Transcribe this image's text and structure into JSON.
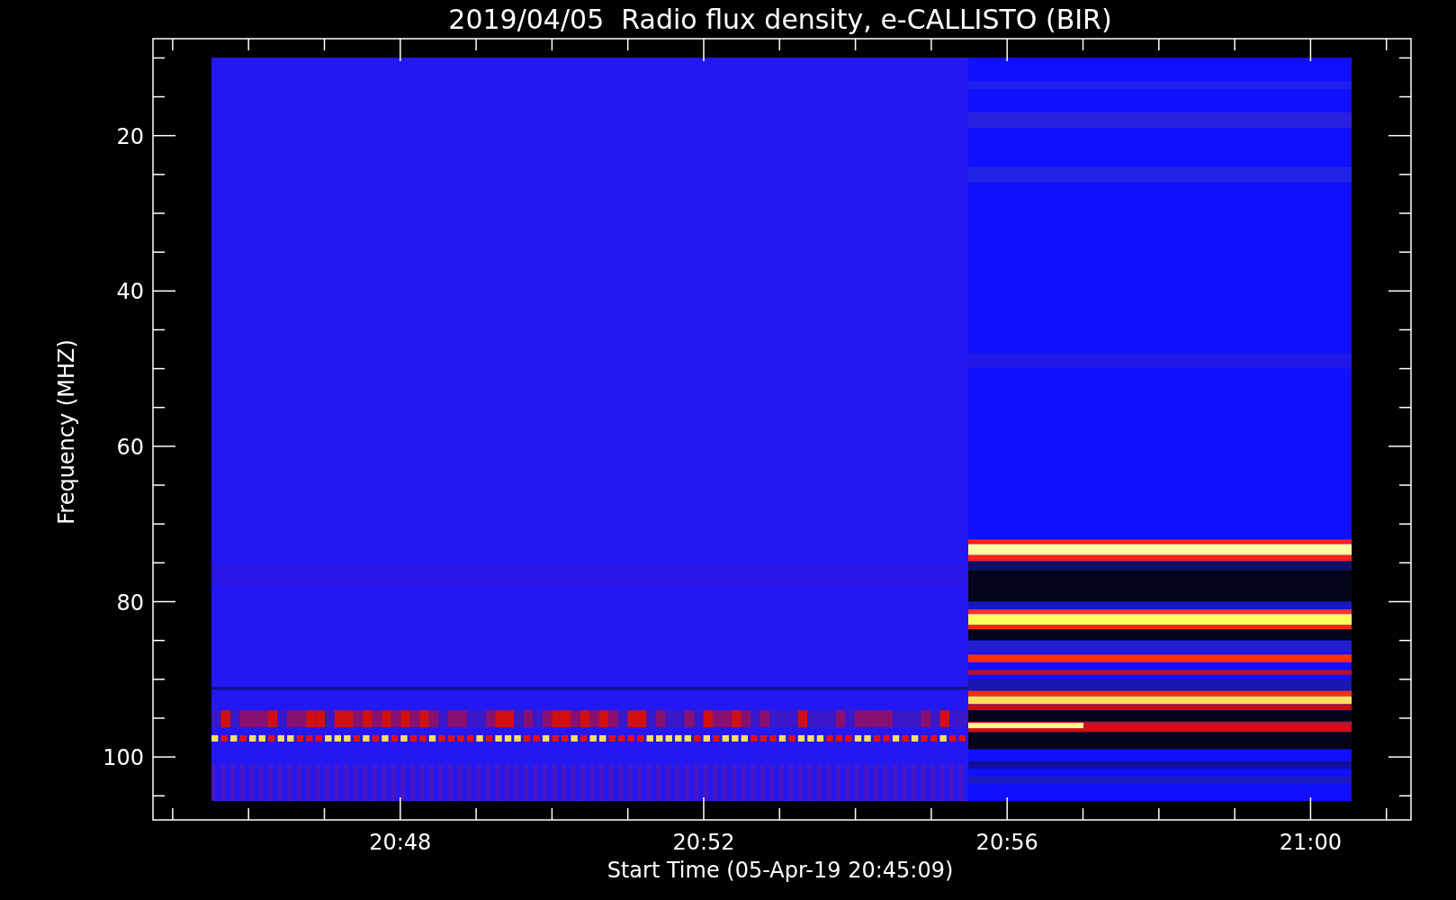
{
  "title": "2019/04/05  Radio flux density, e-CALLISTO (BIR)",
  "y_axis": {
    "label": "Frequency (MHZ)",
    "tick_labels": [
      "20",
      "40",
      "60",
      "80",
      "100"
    ]
  },
  "x_axis": {
    "label": "Start Time (05-Apr-19 20:45:09)",
    "tick_labels": [
      "20:48",
      "20:52",
      "20:56",
      "21:00"
    ]
  }
}
